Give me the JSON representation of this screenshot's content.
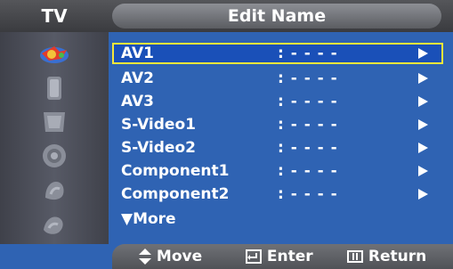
{
  "header": {
    "source_label": "TV",
    "title": "Edit Name"
  },
  "sidebar": {
    "icons": [
      "picture-icon",
      "sound-icon",
      "channel-icon",
      "setup-icon",
      "input-icon",
      "digital-icon"
    ]
  },
  "list": {
    "rows": [
      {
        "name": "AV1",
        "value": ": - - - -",
        "selected": true
      },
      {
        "name": "AV2",
        "value": ": - - - -",
        "selected": false
      },
      {
        "name": "AV3",
        "value": ": - - - -",
        "selected": false
      },
      {
        "name": "S-Video1",
        "value": ": - - - -",
        "selected": false
      },
      {
        "name": "S-Video2",
        "value": ": - - - -",
        "selected": false
      },
      {
        "name": "Component1",
        "value": ": - - - -",
        "selected": false
      },
      {
        "name": "Component2",
        "value": ": - - - -",
        "selected": false
      }
    ],
    "more_label": "▼More"
  },
  "footer": {
    "move_label": "Move",
    "enter_label": "Enter",
    "return_label": "Return"
  },
  "colors": {
    "background": "#2f63b3",
    "highlight_border": "#f5e63a",
    "text": "#ffffff"
  }
}
